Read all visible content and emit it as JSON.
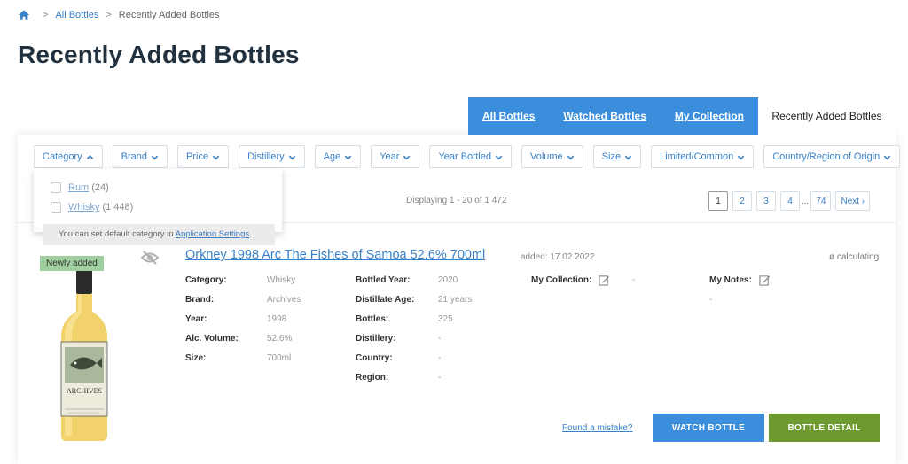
{
  "breadcrumb": {
    "home_icon": "home-icon",
    "separator": ">",
    "link_label": "All Bottles",
    "current": "Recently Added Bottles"
  },
  "page": {
    "title": "Recently Added Bottles"
  },
  "tabs": [
    {
      "label": "All Bottles",
      "active": false
    },
    {
      "label": "Watched Bottles",
      "active": false
    },
    {
      "label": "My Collection",
      "active": false
    },
    {
      "label": "Recently Added Bottles",
      "active": true
    }
  ],
  "filters": [
    {
      "label": "Category",
      "open": true
    },
    {
      "label": "Brand",
      "open": false
    },
    {
      "label": "Price",
      "open": false
    },
    {
      "label": "Distillery",
      "open": false
    },
    {
      "label": "Age",
      "open": false
    },
    {
      "label": "Year",
      "open": false
    },
    {
      "label": "Year Bottled",
      "open": false
    },
    {
      "label": "Volume",
      "open": false
    },
    {
      "label": "Size",
      "open": false
    },
    {
      "label": "Limited/Common",
      "open": false
    },
    {
      "label": "Country/Region of Origin",
      "open": false
    }
  ],
  "category_dropdown": {
    "options": [
      {
        "label": "Rum",
        "count": "(24)",
        "checked": false
      },
      {
        "label": "Whisky",
        "count": "(1 448)",
        "checked": false
      }
    ],
    "note_text": "You can set default category in ",
    "note_link": "Application Settings",
    "note_end": "."
  },
  "results": {
    "displaying": "Displaying 1 - 20 of 1 472"
  },
  "pagination": {
    "pages": [
      "1",
      "2",
      "3",
      "4"
    ],
    "current": "1",
    "ellipsis": "...",
    "last": "74",
    "next": "Next ›"
  },
  "bottle": {
    "badge": "Newly added",
    "title": "Orkney 1998 Arc The Fishes of Samoa 52.6% 700ml",
    "added": "added: 17.02.2022",
    "rating": "ø calculating",
    "col1": [
      {
        "label": "Category:",
        "value": "Whisky"
      },
      {
        "label": "Brand:",
        "value": "Archives"
      },
      {
        "label": "Year:",
        "value": "1998"
      },
      {
        "label": "Alc. Volume:",
        "value": "52.6%"
      },
      {
        "label": "Size:",
        "value": "700ml"
      }
    ],
    "col2": [
      {
        "label": "Bottled Year:",
        "value": "2020"
      },
      {
        "label": "Distillate Age:",
        "value": "21 years"
      },
      {
        "label": "Bottles:",
        "value": "325"
      },
      {
        "label": "Distillery:",
        "value": "-"
      },
      {
        "label": "Country:",
        "value": "-"
      },
      {
        "label": "Region:",
        "value": "-"
      }
    ],
    "my_collection": {
      "label": "My Collection:",
      "value": "-"
    },
    "my_notes": {
      "label": "My Notes:",
      "value": "-"
    },
    "label_text": "ARCHIVES"
  },
  "actions": {
    "found_mistake": "Found a mistake?",
    "watch": "WATCH BOTTLE",
    "detail": "BOTTLE DETAIL"
  },
  "colors": {
    "primary": "#3a8edb",
    "link": "#3a80c6",
    "detail_button": "#6c9a2f",
    "badge": "#9fcf9f",
    "title": "#22313f"
  }
}
